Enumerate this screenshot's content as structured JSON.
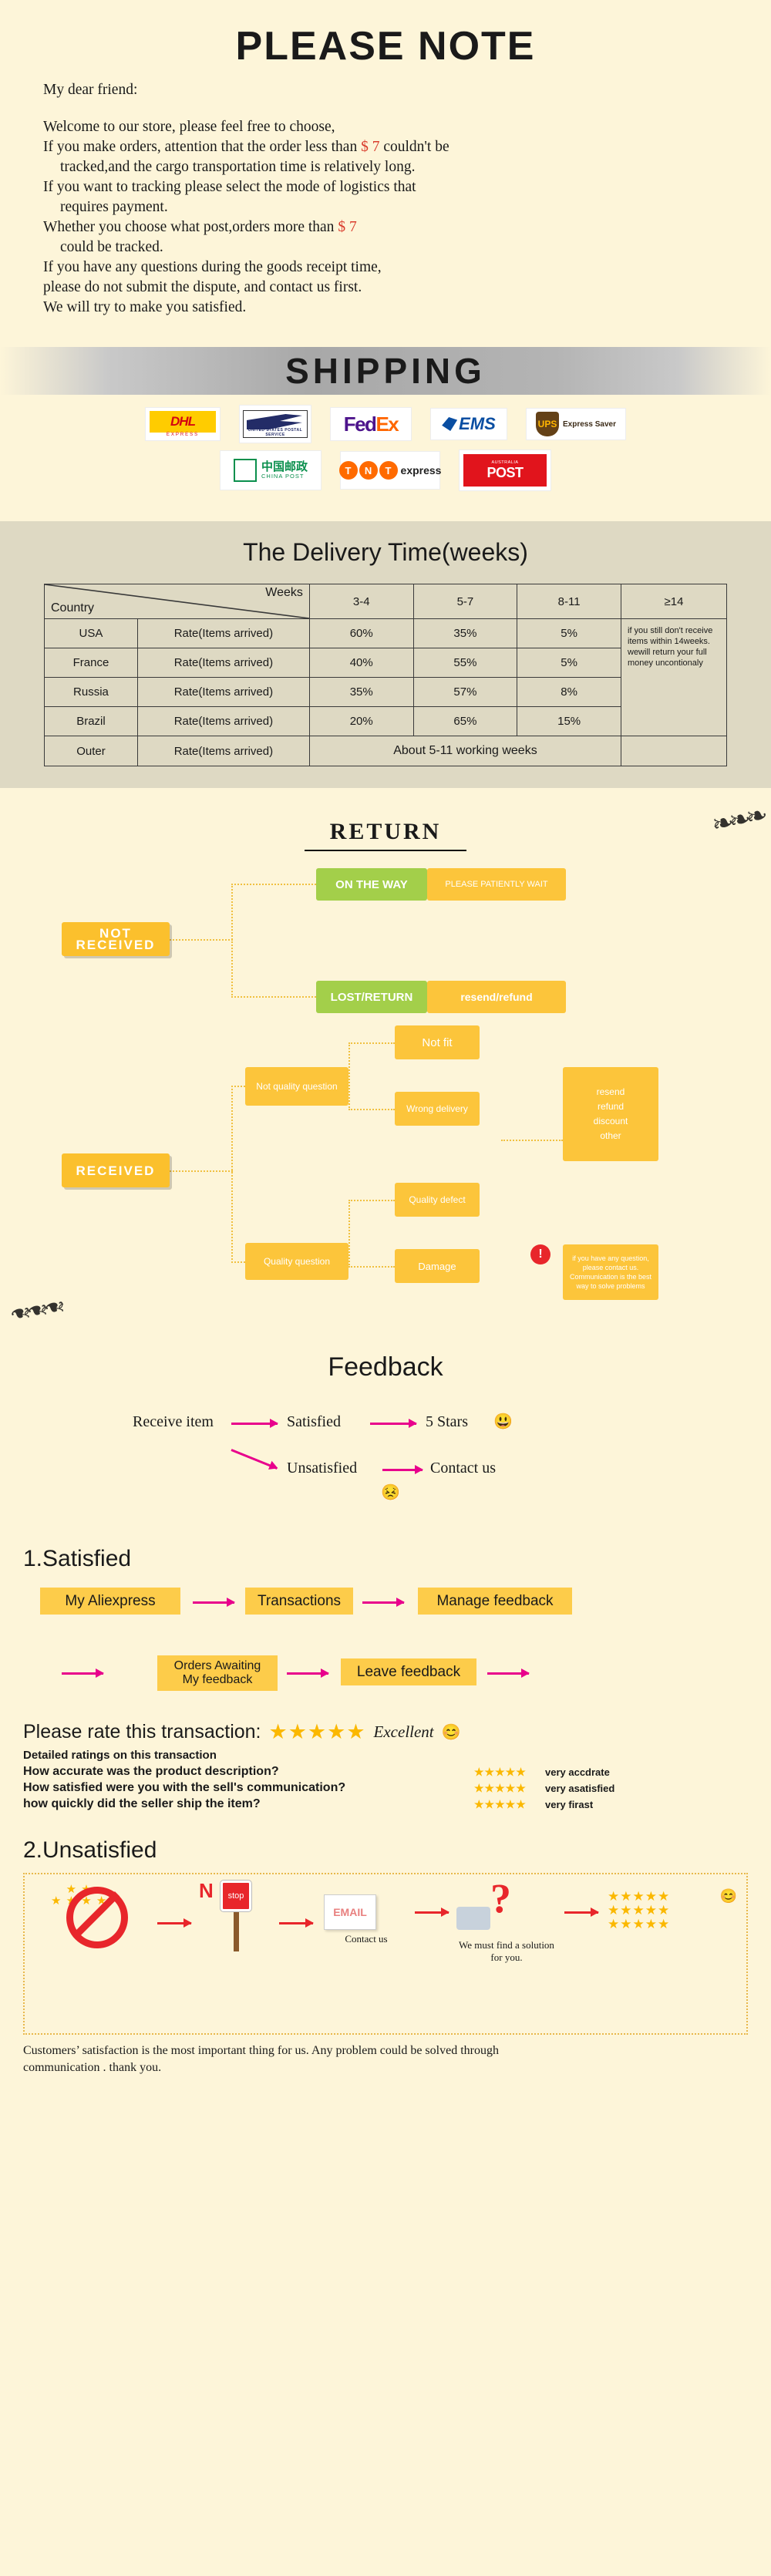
{
  "note": {
    "title": "PLEASE NOTE",
    "greeting": "My dear friend:",
    "line1": "Welcome to our store, please feel free to choose,",
    "line2_a": "If you make orders, attention that the order less than",
    "line2_price": "$ 7",
    "line2_b": "couldn't be",
    "line3": "tracked,and the cargo transportation time is relatively long.",
    "line4": "If you want to tracking please select the mode of logistics that",
    "line5": "requires payment.",
    "line6_a": "Whether you choose what post,orders more than",
    "line6_price": "$ 7",
    "line7": "could be tracked.",
    "line8": "If you have any questions during the goods receipt time,",
    "line9": "please do not submit the dispute, and contact us first.",
    "line10": "We will try to make you satisfied."
  },
  "shipping": {
    "banner": "SHIPPING",
    "carriers": [
      {
        "name": "DHL",
        "sub": "EXPRESS"
      },
      {
        "name": "USPS",
        "sub": "UNITED STATES POSTAL SERVICE"
      },
      {
        "name": "FedEx",
        "fed": "Fed",
        "ex": "Ex"
      },
      {
        "name": "EMS",
        "sub": "EMS"
      },
      {
        "name": "UPS",
        "sub": "Express Saver",
        "mark": "ups"
      },
      {
        "name": "China Post",
        "cn": "中国邮政",
        "en": "CHINA POST"
      },
      {
        "name": "TNT",
        "letters": [
          "T",
          "N",
          "T"
        ],
        "sub": "express"
      },
      {
        "name": "Australia Post",
        "t": "POST",
        "s": "AUSTRALIA"
      }
    ]
  },
  "delivery": {
    "title": "The Delivery Time(weeks)",
    "corner_country": "Country",
    "corner_weeks": "Weeks",
    "columns": [
      "3-4",
      "5-7",
      "8-11",
      "≥14"
    ],
    "rate_label": "Rate(Items arrived)",
    "rows": [
      {
        "country": "USA",
        "rate": "Rate(Items arrived)",
        "values": [
          "60%",
          "35%",
          "5%"
        ]
      },
      {
        "country": "France",
        "rate": "Rate(Items arrived)",
        "values": [
          "40%",
          "55%",
          "5%"
        ]
      },
      {
        "country": "Russia",
        "rate": "Rate(Items arrived)",
        "values": [
          "35%",
          "57%",
          "8%"
        ]
      },
      {
        "country": "Brazil",
        "rate": "Rate(Items arrived)",
        "values": [
          "20%",
          "65%",
          "15%"
        ]
      }
    ],
    "outer_row": {
      "country": "Outer",
      "rate": "Rate(Items arrived)",
      "span_text": "About 5-11 working weeks"
    },
    "side_note": "if you still don't receive items within 14weeks. wewill return your full money uncontionaly"
  },
  "chart_data": {
    "type": "table",
    "title": "The Delivery Time(weeks)",
    "categories": [
      "3-4",
      "5-7",
      "8-11",
      "≥14"
    ],
    "series": [
      {
        "name": "USA",
        "values": [
          60,
          35,
          5,
          null
        ]
      },
      {
        "name": "France",
        "values": [
          40,
          55,
          5,
          null
        ]
      },
      {
        "name": "Russia",
        "values": [
          35,
          57,
          8,
          null
        ]
      },
      {
        "name": "Brazil",
        "values": [
          20,
          65,
          15,
          null
        ]
      }
    ],
    "unit": "%",
    "xlabel": "Weeks",
    "ylabel": "Country",
    "note": "Outer: About 5-11 working weeks"
  },
  "return": {
    "title": "RETURN",
    "not_received": "NOT RECEIVED",
    "received": "RECEIVED",
    "on_the_way": "ON THE WAY",
    "on_the_way_note": "PLEASE PATIENTLY WAIT",
    "lost_return": "LOST/RETURN",
    "lost_return_note": "resend/refund",
    "not_quality": "Not quality question",
    "quality": "Quality question",
    "not_fit": "Not fit",
    "wrong_delivery": "Wrong delivery",
    "quality_defect": "Quality defect",
    "damage": "Damage",
    "resolutions": "resend\nrefund\ndiscount\nother",
    "resolution_lines": [
      "resend",
      "refund",
      "discount",
      "other"
    ],
    "warning_icon": "!",
    "warning_text": "if you have any question, please contact us. Communication is the best way to solve problems"
  },
  "feedback": {
    "title": "Feedback",
    "receive_item": "Receive item",
    "satisfied": "Satisfied",
    "five_stars": "5 Stars",
    "unsatisfied": "Unsatisfied",
    "contact_us": "Contact us",
    "happy_emoji": "😃",
    "sad_emoji": "😣"
  },
  "satisfied": {
    "heading": "1.Satisfied",
    "steps_row1": [
      "My Aliexpress",
      "Transactions",
      "Manage feedback"
    ],
    "steps_row2": [
      "Orders Awaiting\nMy feedback",
      "Leave feedback"
    ],
    "step_orders_l1": "Orders Awaiting",
    "step_orders_l2": "My feedback",
    "step_leave": "Leave feedback"
  },
  "rate": {
    "prompt": "Please rate this transaction:",
    "stars": "★★★★★",
    "excellent": "Excellent",
    "emoji": "😊",
    "detailed_label": "Detailed ratings on this transaction",
    "rows": [
      {
        "question": "How accurate was the product description?",
        "stars": "★★★★★",
        "value": "very accdrate"
      },
      {
        "question": "How satisfied were you with the sell's communication?",
        "stars": "★★★★★",
        "value": "very asatisfied"
      },
      {
        "question": "how quickly did the seller ship the item?",
        "stars": "★★★★★",
        "value": "very firast"
      }
    ]
  },
  "unsatisfied": {
    "heading": "2.Unsatisfied",
    "no_stars_label": "no-low-rating-icon",
    "stop_label": "N",
    "stop_sign_text": "stop",
    "email_label": "EMAIL",
    "contact_caption": "Contact us",
    "question_caption": "We must find a solution for you.",
    "good_stars": "★★★★★",
    "emoji": "😊",
    "footer_line1": "Customers’ satisfaction is the most important thing for us. Any problem could be solved through",
    "footer_line2": "communication . thank you."
  },
  "colors": {
    "bg": "#fdf5d9",
    "yellow": "#fbc02d",
    "green": "#a3cf4a",
    "pink": "#e8008c",
    "red": "#e8262b",
    "star": "#fbb800",
    "table_bg": "#ded9c3"
  }
}
